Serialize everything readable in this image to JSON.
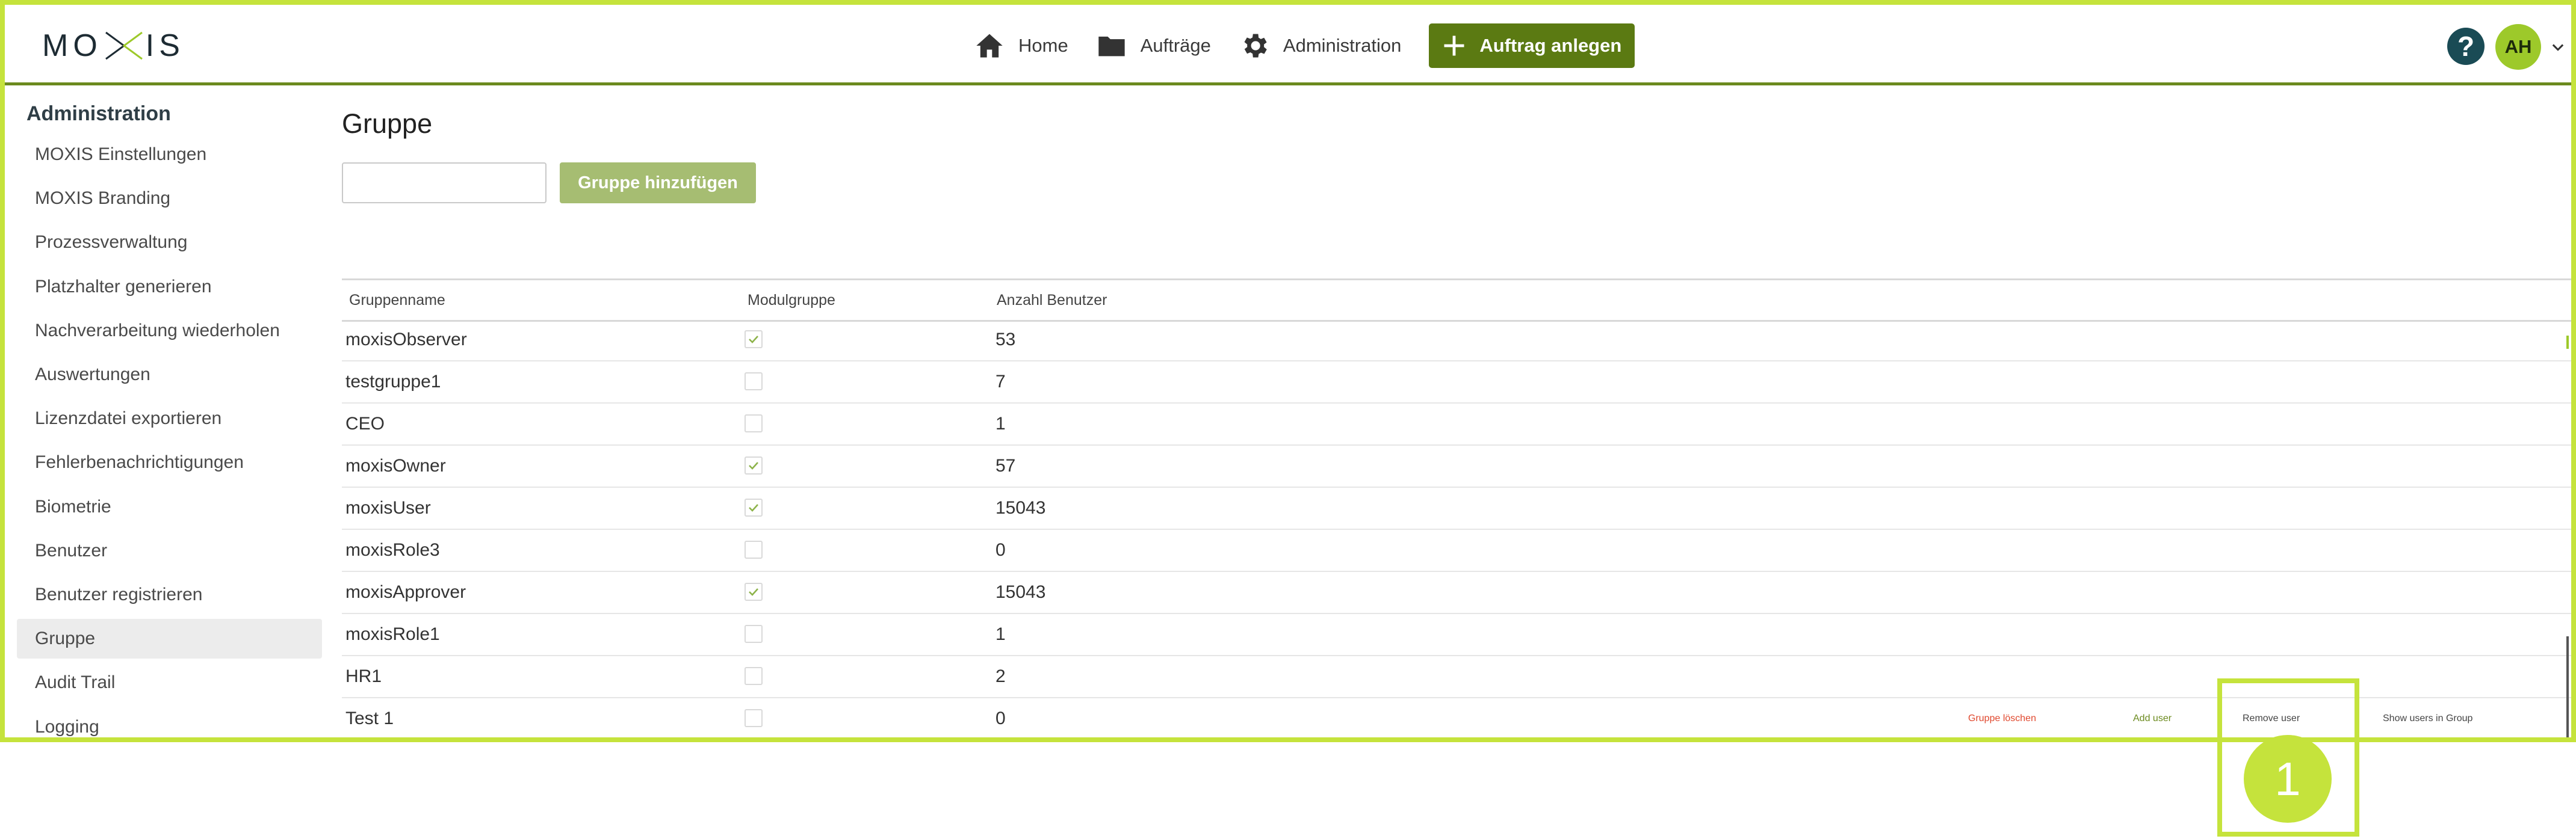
{
  "header": {
    "logo_text": "MOXIS",
    "nav": {
      "home": "Home",
      "orders": "Aufträge",
      "administration": "Administration",
      "create_order": "Auftrag anlegen"
    },
    "help_symbol": "?",
    "avatar_initials": "AH",
    "colors": {
      "frame": "#c5e33c",
      "primary": "#5b7a12",
      "help": "#1a4b55",
      "avatar": "#9dc92a"
    }
  },
  "sidebar": {
    "title": "Administration",
    "items": [
      {
        "label": "MOXIS Einstellungen"
      },
      {
        "label": "MOXIS Branding"
      },
      {
        "label": "Prozessverwaltung"
      },
      {
        "label": "Platzhalter generieren"
      },
      {
        "label": "Nachverarbeitung wiederholen"
      },
      {
        "label": "Auswertungen"
      },
      {
        "label": "Lizenzdatei exportieren"
      },
      {
        "label": "Fehlerbenachrichtigungen"
      },
      {
        "label": "Biometrie"
      },
      {
        "label": "Benutzer"
      },
      {
        "label": "Benutzer registrieren"
      },
      {
        "label": "Gruppe",
        "active": true
      },
      {
        "label": "Audit Trail"
      },
      {
        "label": "Logging"
      }
    ]
  },
  "main": {
    "title": "Gruppe",
    "new_group_input_value": "",
    "add_group_label": "Gruppe hinzufügen",
    "table": {
      "headers": {
        "name": "Gruppenname",
        "module": "Modulgruppe",
        "count": "Anzahl Benutzer"
      },
      "rows": [
        {
          "name": "moxisObserver",
          "module_group": true,
          "count": "53"
        },
        {
          "name": "testgruppe1",
          "module_group": false,
          "count": "7"
        },
        {
          "name": "CEO",
          "module_group": false,
          "count": "1"
        },
        {
          "name": "moxisOwner",
          "module_group": true,
          "count": "57"
        },
        {
          "name": "moxisUser",
          "module_group": true,
          "count": "15043"
        },
        {
          "name": "moxisRole3",
          "module_group": false,
          "count": "0"
        },
        {
          "name": "moxisApprover",
          "module_group": true,
          "count": "15043"
        },
        {
          "name": "moxisRole1",
          "module_group": false,
          "count": "1"
        },
        {
          "name": "HR1",
          "module_group": false,
          "count": "2"
        },
        {
          "name": "Test 1",
          "module_group": false,
          "count": "0"
        }
      ],
      "row_actions": {
        "delete": "Gruppe löschen",
        "add_user": "Add user",
        "remove_user": "Remove user",
        "show_users": "Show users in Group"
      },
      "colors": {
        "delete": "#e0492f",
        "add_user": "#6b8a1e",
        "neutral": "#444444",
        "check": "#8db34a"
      }
    }
  },
  "callout": {
    "number": "1"
  }
}
